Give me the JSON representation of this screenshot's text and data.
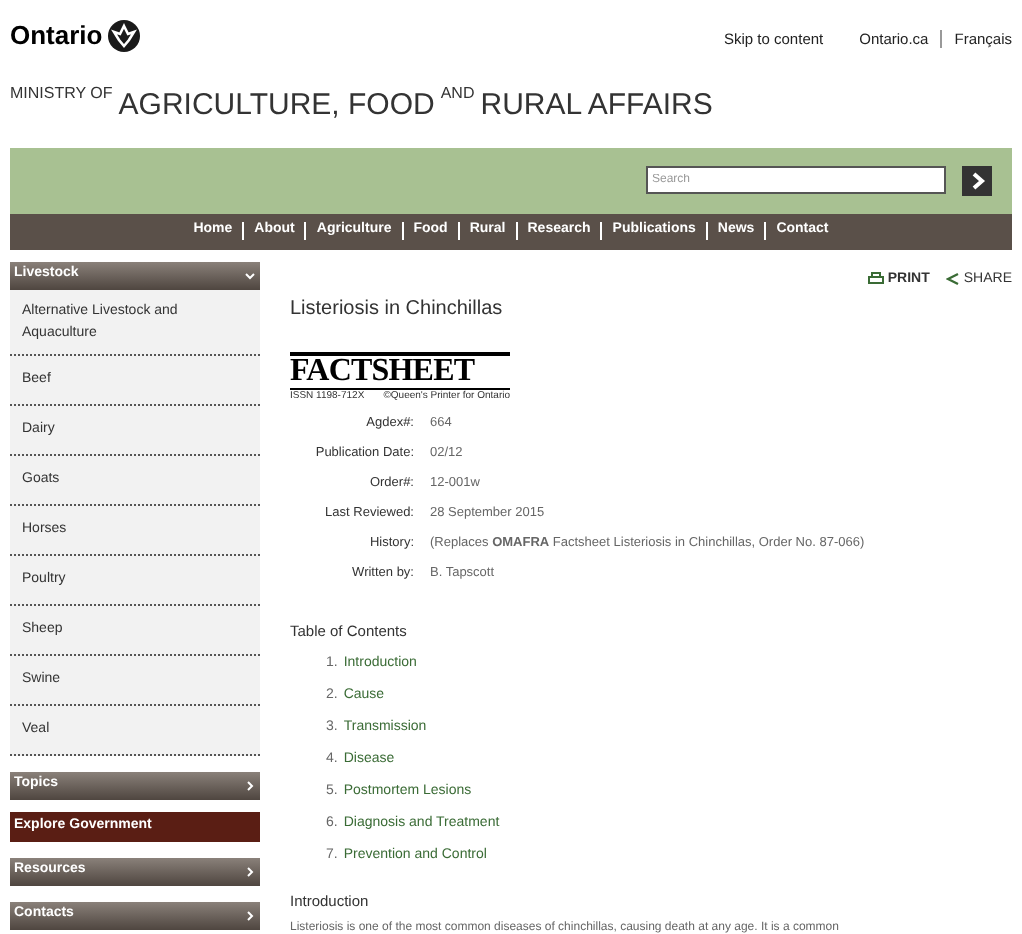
{
  "header": {
    "brand": "Ontario",
    "links": [
      {
        "label": "Skip to content"
      },
      {
        "label": "Ontario.ca"
      },
      {
        "label": "Français"
      }
    ],
    "ministry": [
      {
        "text": "MINISTRY OF",
        "kind": "small"
      },
      {
        "text": "AGRICULTURE, FOOD",
        "kind": "large"
      },
      {
        "text": "AND",
        "kind": "small"
      },
      {
        "text": "RURAL AFFAIRS",
        "kind": "large"
      }
    ]
  },
  "search": {
    "placeholder": "Search"
  },
  "nav": [
    "Home",
    "About",
    "Agriculture",
    "Food",
    "Rural",
    "Research",
    "Publications",
    "News",
    "Contact"
  ],
  "sidebar": [
    {
      "label": "Livestock",
      "kind": "section",
      "expanded": true,
      "children": [
        {
          "label": "Alternative Livestock and Aquaculture"
        },
        {
          "label": "Beef"
        },
        {
          "label": "Dairy"
        },
        {
          "label": "Goats"
        },
        {
          "label": "Horses"
        },
        {
          "label": "Poultry"
        },
        {
          "label": "Sheep"
        },
        {
          "label": "Swine"
        },
        {
          "label": "Veal"
        }
      ]
    },
    {
      "label": "Topics",
      "kind": "section",
      "expanded": false
    },
    {
      "label": "Explore Government",
      "kind": "highlight"
    },
    {
      "label": "Resources",
      "kind": "section",
      "expanded": false
    },
    {
      "label": "Contacts",
      "kind": "section",
      "expanded": false
    }
  ],
  "actions": [
    "PRINT",
    "SHARE"
  ],
  "title": "Listeriosis in Chinchillas",
  "factsheet": {
    "logo": "FACTSHEET",
    "issn": "ISSN 1198-712X",
    "printer": "©Queen's Printer for Ontario"
  },
  "meta": [
    {
      "label": "Agdex#:",
      "value": "664"
    },
    {
      "label": "Publication Date:",
      "value": "02/12"
    },
    {
      "label": "Order#:",
      "value": "12-001w"
    },
    {
      "label": "Last Reviewed:",
      "value": "28 September 2015"
    },
    {
      "label": "History:",
      "value": "(Replaces **OMAFRA** Factsheet Listeriosis in Chinchillas, Order No. 87-066)"
    },
    {
      "label": "Written by:",
      "value": "B. Tapscott"
    }
  ],
  "toc": {
    "heading": "Table of Contents",
    "items": [
      {
        "number": "1.",
        "label": "Introduction"
      },
      {
        "number": "2.",
        "label": "Cause"
      },
      {
        "number": "3.",
        "label": "Transmission"
      },
      {
        "number": "4.",
        "label": "Disease"
      },
      {
        "number": "5.",
        "label": "Postmortem Lesions"
      },
      {
        "number": "6.",
        "label": "Diagnosis and Treatment"
      },
      {
        "number": "7.",
        "label": "Prevention and Control"
      }
    ]
  },
  "section": {
    "heading": "Introduction",
    "body": "Listeriosis is one of the most common diseases of chinchillas, causing death at any age. It is a common"
  }
}
